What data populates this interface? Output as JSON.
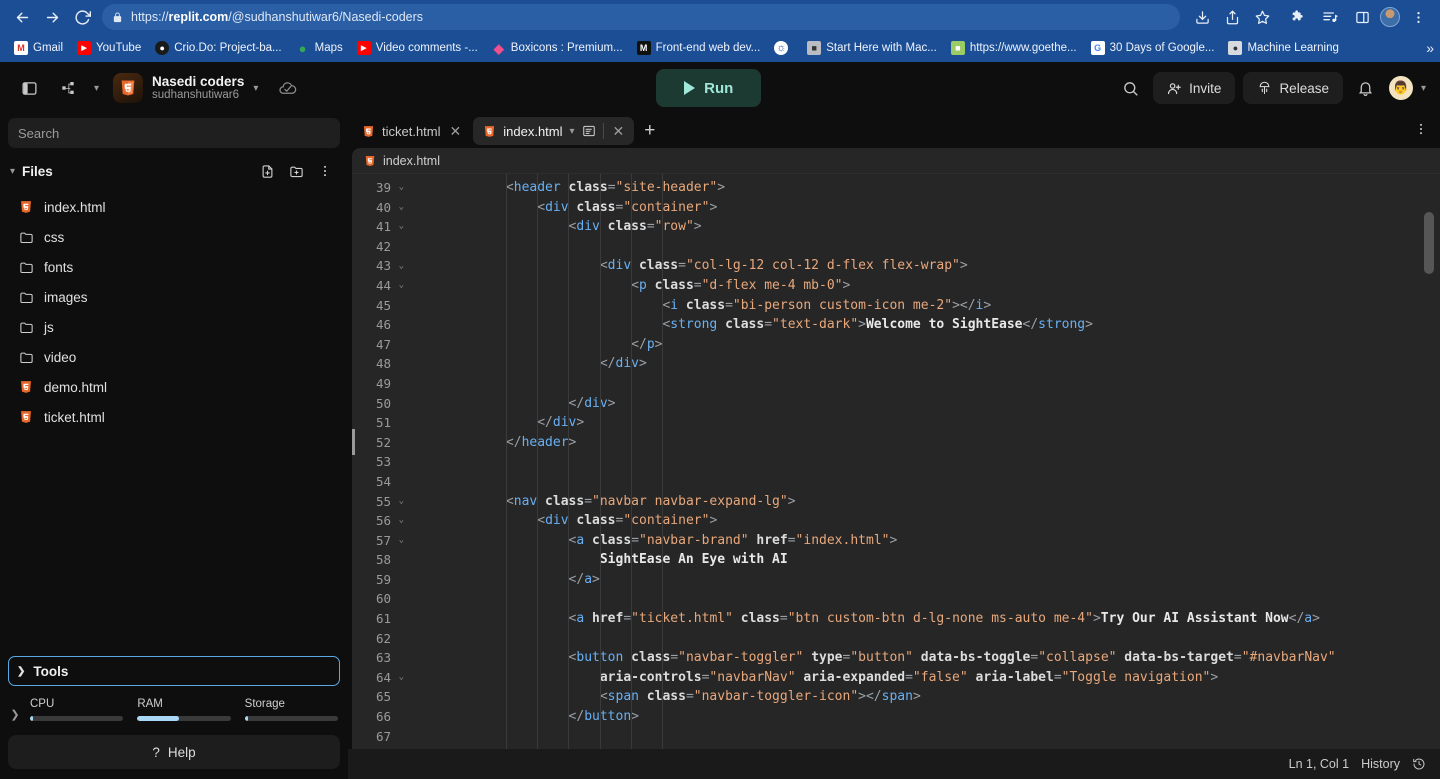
{
  "browser": {
    "url_prefix": "https://",
    "url_host": "replit.com",
    "url_path": "/@sudhanshutiwar6/Nasedi-coders",
    "nav": {
      "back": "back-arrow",
      "forward": "forward-arrow",
      "reload": "reload",
      "lock": "site-secure-lock"
    },
    "bookmarks": [
      {
        "label": "Gmail",
        "icon": "M",
        "color": "#ffffff",
        "fg": "#d93025"
      },
      {
        "label": "YouTube",
        "icon": "▶",
        "color": "#ff0000",
        "fg": "#ffffff"
      },
      {
        "label": "Crio.Do: Project-ba...",
        "icon": "●",
        "color": "#1a1a1a",
        "fg": "#ffffff"
      },
      {
        "label": "Maps",
        "icon": "●",
        "color": "#34a853",
        "fg": "#ffffff"
      },
      {
        "label": "Video comments -...",
        "icon": "▶",
        "color": "#ff0000",
        "fg": "#ffffff"
      },
      {
        "label": "Boxicons : Premium...",
        "icon": "◆",
        "color": "#f24e8e",
        "fg": "#ffffff"
      },
      {
        "label": "Front-end web dev...",
        "icon": "M",
        "color": "#111111",
        "fg": "#ffffff"
      },
      {
        "label": "",
        "icon": "●",
        "color": "#ffffff",
        "fg": "#1c4e96"
      },
      {
        "label": "Start Here with Mac...",
        "icon": "■",
        "color": "#b9bcc2",
        "fg": "#333333"
      },
      {
        "label": "https://www.goethe...",
        "icon": "■",
        "color": "#9ccc65",
        "fg": "#ffffff"
      },
      {
        "label": "30 Days of Google...",
        "icon": "G",
        "color": "#ffffff",
        "fg": "#4285f4"
      },
      {
        "label": "Machine Learning",
        "icon": "●",
        "color": "#d7dbe0",
        "fg": "#333333"
      }
    ],
    "bookmarks_overflow": "»",
    "toolbar_icons": [
      "install-icon",
      "share-icon",
      "bookmark-star-icon",
      "extensions-puzzle-icon",
      "reading-list-icon",
      "side-panel-icon",
      "profile-avatar",
      "chrome-menu-kebab"
    ]
  },
  "topbar": {
    "sidebar_toggle_icon": "panel-toggle-icon",
    "tree_icon": "git-branch-icon",
    "project_name": "Nasedi coders",
    "project_owner": "sudhanshutiwar6",
    "saved_icon": "cloud-check-icon",
    "run_label": "Run",
    "search_icon": "search-icon",
    "invite_label": "Invite",
    "release_label": "Release",
    "bell_icon": "notification-bell-icon",
    "avatar": "👨"
  },
  "sidebar": {
    "search_placeholder": "Search",
    "search_value": "",
    "files_title": "Files",
    "new_file_icon": "new-file-icon",
    "new_folder_icon": "new-folder-icon",
    "files_menu_icon": "kebab-menu-icon",
    "files": [
      {
        "name": "index.html",
        "type": "html"
      },
      {
        "name": "css",
        "type": "folder"
      },
      {
        "name": "fonts",
        "type": "folder"
      },
      {
        "name": "images",
        "type": "folder"
      },
      {
        "name": "js",
        "type": "folder"
      },
      {
        "name": "video",
        "type": "folder"
      },
      {
        "name": "demo.html",
        "type": "html"
      },
      {
        "name": "ticket.html",
        "type": "html"
      }
    ],
    "tools_label": "Tools",
    "resources": [
      {
        "label": "CPU",
        "percent": 3
      },
      {
        "label": "RAM",
        "percent": 45
      },
      {
        "label": "Storage",
        "percent": 4
      }
    ],
    "help_label": "Help"
  },
  "editor": {
    "tabs": [
      {
        "label": "ticket.html",
        "active": false
      },
      {
        "label": "index.html",
        "active": true
      }
    ],
    "add_tab_label": "+",
    "pane_menu_icon": "kebab-menu-icon",
    "preview_icon": "preview-pane-icon",
    "breadcrumb": "index.html",
    "status": {
      "position": "Ln 1, Col 1",
      "history_label": "History",
      "history_icon": "history-clock-icon"
    },
    "lines": [
      {
        "n": 39,
        "fold": true,
        "tokens": [
          [
            "punct",
            "            <"
          ],
          [
            "tag",
            "header"
          ],
          [
            "attr",
            " class"
          ],
          [
            "punct",
            "="
          ],
          [
            "str",
            "\"site-header\""
          ],
          [
            "punct",
            ">"
          ]
        ]
      },
      {
        "n": 40,
        "fold": true,
        "tokens": [
          [
            "punct",
            "                <"
          ],
          [
            "tag",
            "div"
          ],
          [
            "attr",
            " class"
          ],
          [
            "punct",
            "="
          ],
          [
            "str",
            "\"container\""
          ],
          [
            "punct",
            ">"
          ]
        ]
      },
      {
        "n": 41,
        "fold": true,
        "tokens": [
          [
            "punct",
            "                    <"
          ],
          [
            "tag",
            "div"
          ],
          [
            "attr",
            " class"
          ],
          [
            "punct",
            "="
          ],
          [
            "str",
            "\"row\""
          ],
          [
            "punct",
            ">"
          ]
        ]
      },
      {
        "n": 42,
        "fold": false,
        "tokens": [
          [
            "punct",
            ""
          ]
        ]
      },
      {
        "n": 43,
        "fold": true,
        "tokens": [
          [
            "punct",
            "                        <"
          ],
          [
            "tag",
            "div"
          ],
          [
            "attr",
            " class"
          ],
          [
            "punct",
            "="
          ],
          [
            "str",
            "\"col-lg-12 col-12 d-flex flex-wrap\""
          ],
          [
            "punct",
            ">"
          ]
        ]
      },
      {
        "n": 44,
        "fold": true,
        "tokens": [
          [
            "punct",
            "                            <"
          ],
          [
            "tag",
            "p"
          ],
          [
            "attr",
            " class"
          ],
          [
            "punct",
            "="
          ],
          [
            "str",
            "\"d-flex me-4 mb-0\""
          ],
          [
            "punct",
            ">"
          ]
        ]
      },
      {
        "n": 45,
        "fold": false,
        "tokens": [
          [
            "punct",
            "                                <"
          ],
          [
            "tag",
            "i"
          ],
          [
            "attr",
            " class"
          ],
          [
            "punct",
            "="
          ],
          [
            "str",
            "\"bi-person custom-icon me-2\""
          ],
          [
            "punct",
            "></"
          ],
          [
            "tag",
            "i"
          ],
          [
            "punct",
            ">"
          ]
        ]
      },
      {
        "n": 46,
        "fold": false,
        "tokens": [
          [
            "punct",
            "                                <"
          ],
          [
            "tag",
            "strong"
          ],
          [
            "attr",
            " class"
          ],
          [
            "punct",
            "="
          ],
          [
            "str",
            "\"text-dark\""
          ],
          [
            "punct",
            ">"
          ],
          [
            "txt",
            "Welcome to SightEase"
          ],
          [
            "punct",
            "</"
          ],
          [
            "tag",
            "strong"
          ],
          [
            "punct",
            ">"
          ]
        ]
      },
      {
        "n": 47,
        "fold": false,
        "tokens": [
          [
            "punct",
            "                            </"
          ],
          [
            "tag",
            "p"
          ],
          [
            "punct",
            ">"
          ]
        ]
      },
      {
        "n": 48,
        "fold": false,
        "tokens": [
          [
            "punct",
            "                        </"
          ],
          [
            "tag",
            "div"
          ],
          [
            "punct",
            ">"
          ]
        ]
      },
      {
        "n": 49,
        "fold": false,
        "tokens": [
          [
            "punct",
            ""
          ]
        ]
      },
      {
        "n": 50,
        "fold": false,
        "tokens": [
          [
            "punct",
            "                    </"
          ],
          [
            "tag",
            "div"
          ],
          [
            "punct",
            ">"
          ]
        ]
      },
      {
        "n": 51,
        "fold": false,
        "tokens": [
          [
            "punct",
            "                </"
          ],
          [
            "tag",
            "div"
          ],
          [
            "punct",
            ">"
          ]
        ]
      },
      {
        "n": 52,
        "fold": false,
        "tokens": [
          [
            "punct",
            "            </"
          ],
          [
            "tag",
            "header"
          ],
          [
            "punct",
            ">"
          ]
        ]
      },
      {
        "n": 53,
        "fold": false,
        "tokens": [
          [
            "punct",
            ""
          ]
        ]
      },
      {
        "n": 54,
        "fold": false,
        "tokens": [
          [
            "punct",
            ""
          ]
        ]
      },
      {
        "n": 55,
        "fold": true,
        "tokens": [
          [
            "punct",
            "            <"
          ],
          [
            "tag",
            "nav"
          ],
          [
            "attr",
            " class"
          ],
          [
            "punct",
            "="
          ],
          [
            "str",
            "\"navbar navbar-expand-lg\""
          ],
          [
            "punct",
            ">"
          ]
        ]
      },
      {
        "n": 56,
        "fold": true,
        "tokens": [
          [
            "punct",
            "                <"
          ],
          [
            "tag",
            "div"
          ],
          [
            "attr",
            " class"
          ],
          [
            "punct",
            "="
          ],
          [
            "str",
            "\"container\""
          ],
          [
            "punct",
            ">"
          ]
        ]
      },
      {
        "n": 57,
        "fold": true,
        "tokens": [
          [
            "punct",
            "                    <"
          ],
          [
            "tag",
            "a"
          ],
          [
            "attr",
            " class"
          ],
          [
            "punct",
            "="
          ],
          [
            "str",
            "\"navbar-brand\""
          ],
          [
            "attr",
            " href"
          ],
          [
            "punct",
            "="
          ],
          [
            "str",
            "\"index.html\""
          ],
          [
            "punct",
            ">"
          ]
        ]
      },
      {
        "n": 58,
        "fold": false,
        "tokens": [
          [
            "txt",
            "                        SightEase An Eye with AI"
          ]
        ]
      },
      {
        "n": 59,
        "fold": false,
        "tokens": [
          [
            "punct",
            "                    </"
          ],
          [
            "tag",
            "a"
          ],
          [
            "punct",
            ">"
          ]
        ]
      },
      {
        "n": 60,
        "fold": false,
        "tokens": [
          [
            "punct",
            ""
          ]
        ]
      },
      {
        "n": 61,
        "fold": false,
        "tokens": [
          [
            "punct",
            "                    <"
          ],
          [
            "tag",
            "a"
          ],
          [
            "attr",
            " href"
          ],
          [
            "punct",
            "="
          ],
          [
            "str",
            "\"ticket.html\""
          ],
          [
            "attr",
            " class"
          ],
          [
            "punct",
            "="
          ],
          [
            "str",
            "\"btn custom-btn d-lg-none ms-auto me-4\""
          ],
          [
            "punct",
            ">"
          ],
          [
            "txt",
            "Try Our AI Assistant Now"
          ],
          [
            "punct",
            "</"
          ],
          [
            "tag",
            "a"
          ],
          [
            "punct",
            ">"
          ]
        ]
      },
      {
        "n": 62,
        "fold": false,
        "tokens": [
          [
            "punct",
            ""
          ]
        ]
      },
      {
        "n": 63,
        "fold": false,
        "tokens": [
          [
            "punct",
            "                    <"
          ],
          [
            "tag",
            "button"
          ],
          [
            "attr",
            " class"
          ],
          [
            "punct",
            "="
          ],
          [
            "str",
            "\"navbar-toggler\""
          ],
          [
            "attr",
            " type"
          ],
          [
            "punct",
            "="
          ],
          [
            "str",
            "\"button\""
          ],
          [
            "attr",
            " data-bs-toggle"
          ],
          [
            "punct",
            "="
          ],
          [
            "str",
            "\"collapse\""
          ],
          [
            "attr",
            " data-bs-target"
          ],
          [
            "punct",
            "="
          ],
          [
            "str",
            "\"#navbarNav\""
          ]
        ]
      },
      {
        "n": 64,
        "fold": true,
        "tokens": [
          [
            "attr",
            "                        aria-controls"
          ],
          [
            "punct",
            "="
          ],
          [
            "str",
            "\"navbarNav\""
          ],
          [
            "attr",
            " aria-expanded"
          ],
          [
            "punct",
            "="
          ],
          [
            "str",
            "\"false\""
          ],
          [
            "attr",
            " aria-label"
          ],
          [
            "punct",
            "="
          ],
          [
            "str",
            "\"Toggle navigation\""
          ],
          [
            "punct",
            ">"
          ]
        ]
      },
      {
        "n": 65,
        "fold": false,
        "tokens": [
          [
            "punct",
            "                        <"
          ],
          [
            "tag",
            "span"
          ],
          [
            "attr",
            " class"
          ],
          [
            "punct",
            "="
          ],
          [
            "str",
            "\"navbar-toggler-icon\""
          ],
          [
            "punct",
            "></"
          ],
          [
            "tag",
            "span"
          ],
          [
            "punct",
            ">"
          ]
        ]
      },
      {
        "n": 66,
        "fold": false,
        "tokens": [
          [
            "punct",
            "                    </"
          ],
          [
            "tag",
            "button"
          ],
          [
            "punct",
            ">"
          ]
        ]
      },
      {
        "n": 67,
        "fold": false,
        "tokens": [
          [
            "punct",
            ""
          ]
        ]
      }
    ]
  },
  "colors": {
    "browser_blue": "#1c4e96",
    "app_bg": "#0e0e0e",
    "editor_bg": "#262626",
    "run_bg": "#1d3a32",
    "run_fg": "#9fe7d8",
    "accent_blue": "#5aa9e6",
    "html_orange": "#e8672a"
  }
}
